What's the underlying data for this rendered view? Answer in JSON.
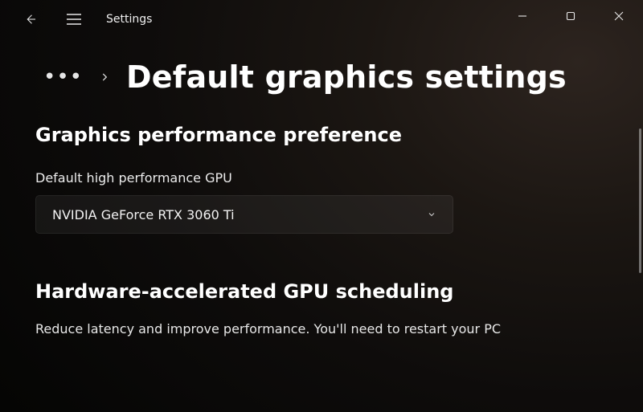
{
  "titlebar": {
    "app_title": "Settings"
  },
  "breadcrumb": {
    "ellipsis": "•••",
    "page_title": "Default graphics settings"
  },
  "section1": {
    "heading": "Graphics performance preference",
    "field_label": "Default high performance GPU",
    "dropdown_value": "NVIDIA GeForce RTX 3060 Ti"
  },
  "section2": {
    "heading": "Hardware-accelerated GPU scheduling",
    "description": "Reduce latency and improve performance. You'll need to restart your PC"
  }
}
